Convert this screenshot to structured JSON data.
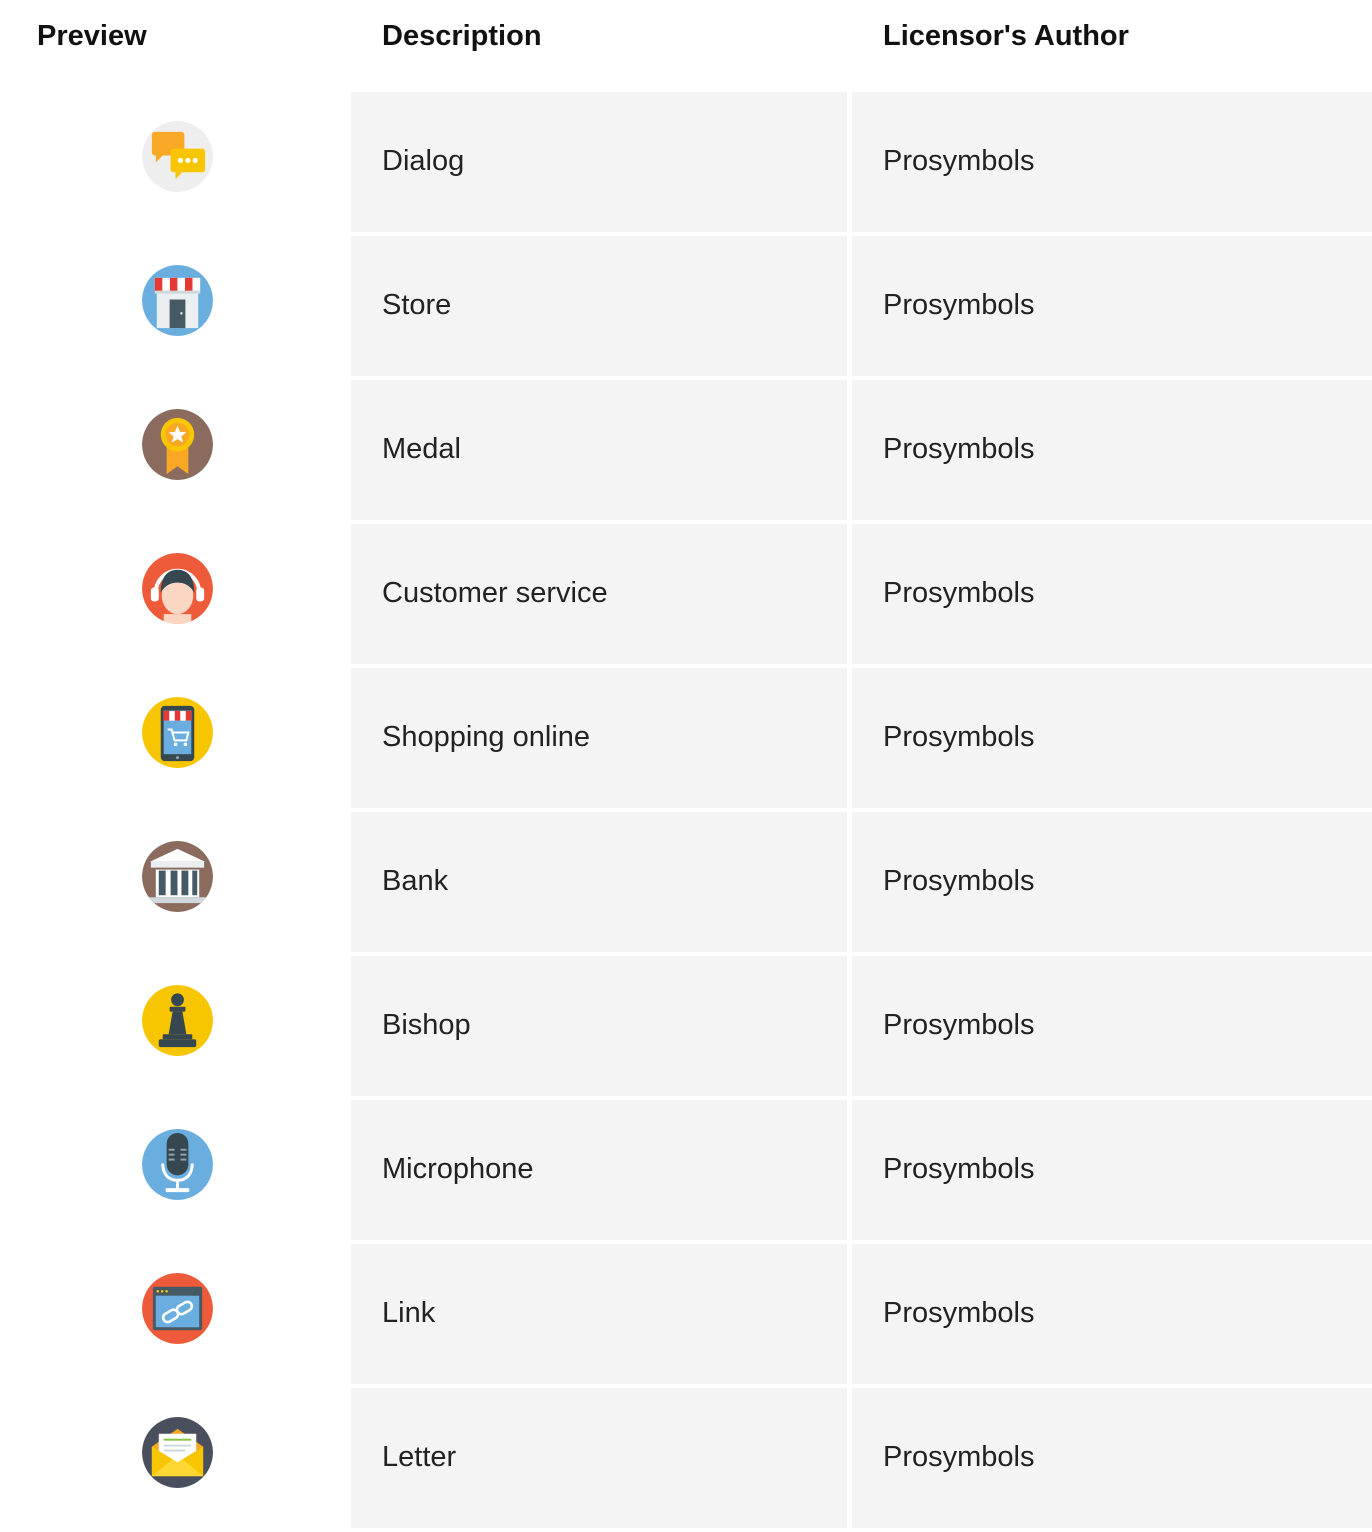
{
  "table": {
    "headers": {
      "preview": "Preview",
      "description": "Description",
      "author": "Licensor's Author"
    },
    "rows": [
      {
        "icon": "dialog-icon",
        "description": "Dialog",
        "author": "Prosymbols"
      },
      {
        "icon": "store-icon",
        "description": "Store",
        "author": "Prosymbols"
      },
      {
        "icon": "medal-icon",
        "description": "Medal",
        "author": "Prosymbols"
      },
      {
        "icon": "customer-service-icon",
        "description": "Customer service",
        "author": "Prosymbols"
      },
      {
        "icon": "shopping-online-icon",
        "description": "Shopping online",
        "author": "Prosymbols"
      },
      {
        "icon": "bank-icon",
        "description": "Bank",
        "author": "Prosymbols"
      },
      {
        "icon": "bishop-icon",
        "description": "Bishop",
        "author": "Prosymbols"
      },
      {
        "icon": "microphone-icon",
        "description": "Microphone",
        "author": "Prosymbols"
      },
      {
        "icon": "link-icon",
        "description": "Link",
        "author": "Prosymbols"
      },
      {
        "icon": "letter-icon",
        "description": "Letter",
        "author": "Prosymbols"
      }
    ]
  },
  "colors": {
    "cell_background": "#f4f4f4",
    "icon_yellow": "#f7c600",
    "icon_blue": "#6aaedf",
    "icon_brown": "#8a6b5e",
    "icon_red": "#ee5b3a",
    "icon_slate": "#4a4f5e"
  }
}
